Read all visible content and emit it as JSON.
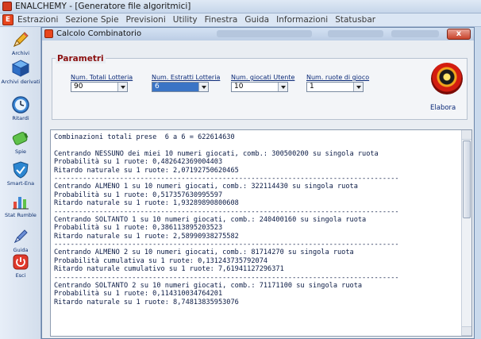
{
  "window": {
    "title": "ENALCHEMY - [Generatore file algoritmici]"
  },
  "menu": [
    "Estrazioni",
    "Sezione Spie",
    "Previsioni",
    "Utility",
    "Finestra",
    "Guida",
    "Informazioni",
    "Statusbar"
  ],
  "sidebar": {
    "items": [
      {
        "label": "Archivi",
        "icon": "pencil-icon"
      },
      {
        "label": "Archivi derivati",
        "icon": "cube-icon"
      },
      {
        "label": "Ritardi",
        "icon": "clock-icon"
      },
      {
        "label": "Spie",
        "icon": "battery-icon"
      },
      {
        "label": "Smart-Ena",
        "icon": "shield-icon"
      },
      {
        "label": "Stat Rumble",
        "icon": "bar-chart-icon"
      },
      {
        "label": "Guida",
        "icon": "help-pen-icon"
      },
      {
        "label": "Esci",
        "icon": "power-icon"
      }
    ]
  },
  "child": {
    "title": "Calcolo Combinatorio",
    "close_label": "x",
    "params_legend": "Parametri",
    "fields": [
      {
        "label": "Num. Totali Lotteria",
        "value": "90"
      },
      {
        "label": "Num. Estratti Lotteria",
        "value": "6"
      },
      {
        "label": "Num. giocati Utente",
        "value": "10"
      },
      {
        "label": "Num. ruote di gioco",
        "value": "1"
      }
    ],
    "elabora_label": "Elabora"
  },
  "output": {
    "lines": [
      "Combinazioni totali prese  6 a 6 = 622614630",
      "",
      "Centrando NESSUNO dei miei 10 numeri giocati, comb.: 300500200 su singola ruota",
      "Probabilità su 1 ruote: 0,482642369004403",
      "Ritardo naturale su 1 ruote: 2,07192750620465",
      "------------------------------------------------------------------------------------",
      "Centrando ALMENO 1 su 10 numeri giocati, comb.: 322114430 su singola ruota",
      "Probabilità su 1 ruote: 0,517357630995597",
      "Ritardo naturale su 1 ruote: 1,93289890800608",
      "------------------------------------------------------------------------------------",
      "Centrando SOLTANTO 1 su 10 numeri giocati, comb.: 240400160 su singola ruota",
      "Probabilità su 1 ruote: 0,386113895203523",
      "Ritardo naturale su 1 ruote: 2,58990938275582",
      "------------------------------------------------------------------------------------",
      "Centrando ALMENO 2 su 10 numeri giocati, comb.: 81714270 su singola ruota",
      "Probabilità cumulativa su 1 ruote: 0,131243735792074",
      "Ritardo naturale cumulativo su 1 ruote: 7,61941127296371",
      "------------------------------------------------------------------------------------",
      "Centrando SOLTANTO 2 su 10 numeri giocati, comb.: 71171100 su singola ruota",
      "Probabilità su 1 ruote: 0,114310034764201",
      "Ritardo naturale su 1 ruote: 8,74813835953076"
    ]
  }
}
